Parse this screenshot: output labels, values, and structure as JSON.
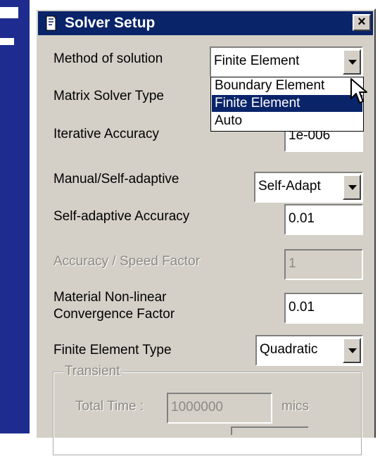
{
  "dialog": {
    "title": "Solver Setup",
    "close_label": "×"
  },
  "method": {
    "label": "Method of solution",
    "value": "Finite Element",
    "options": [
      "Boundary Element",
      "Finite Element",
      "Auto"
    ],
    "selected_index": 1
  },
  "matrix": {
    "label": "Matrix Solver Type"
  },
  "iterative": {
    "label": "Iterative Accuracy",
    "value": "1e-006"
  },
  "manual": {
    "label": "Manual/Self-adaptive",
    "value": "Self-Adapt"
  },
  "self_adaptive": {
    "label": "Self-adaptive Accuracy",
    "value": "0.01"
  },
  "accuracy_speed": {
    "label": "Accuracy / Speed Factor",
    "value": "1",
    "enabled": false
  },
  "material": {
    "label_line1": "Material Non-linear",
    "label_line2": "Convergence Factor",
    "value": "0.01"
  },
  "fe_type": {
    "label": "Finite Element Type",
    "value": "Quadratic"
  },
  "transient": {
    "group_title": "Transient",
    "total_time_label": "Total Time :",
    "total_time_value": "1000000",
    "units": "mics"
  },
  "colors": {
    "titlebar": "#0a246a",
    "dialog_face": "#d4d0c8",
    "selection": "#0a246a",
    "disabled_text": "#8c8a84",
    "backdrop_strip": "#1f2c8f"
  }
}
